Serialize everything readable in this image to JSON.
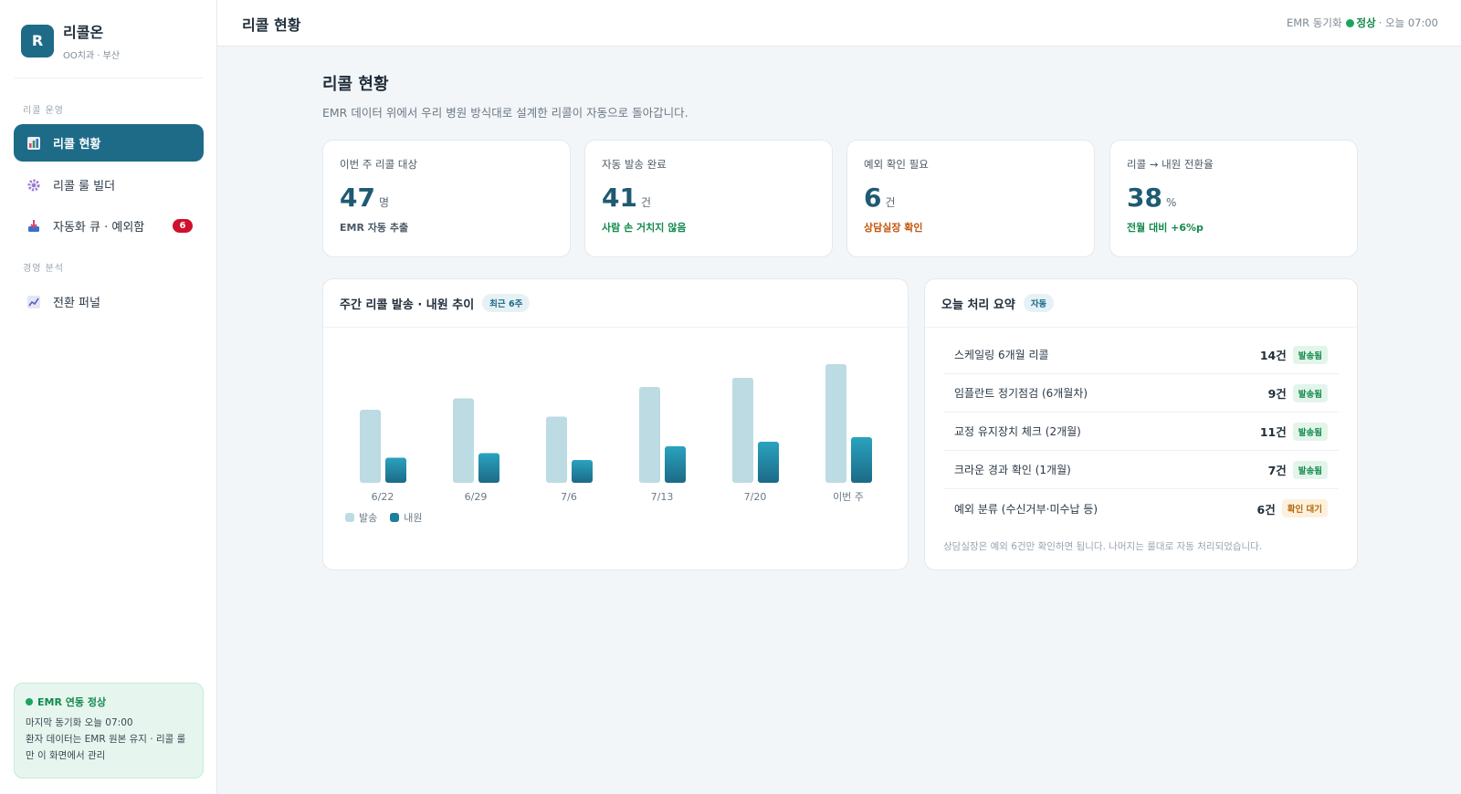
{
  "brand": {
    "initial": "R",
    "name": "리콜온",
    "sub": "OO치과 · 부산"
  },
  "sidebar": {
    "section_recall": "리콜 운영",
    "section_analysis": "경영 분석",
    "items": [
      {
        "label": "리콜 현황",
        "icon": "bar-chart-icon"
      },
      {
        "label": "리콜 룰 빌더",
        "icon": "gear-icon"
      },
      {
        "label": "자동화 큐 · 예외함",
        "icon": "inbox-icon",
        "badge": "6"
      },
      {
        "label": "전환 퍼널",
        "icon": "line-chart-icon"
      }
    ],
    "status": {
      "title": "EMR 연동 정상",
      "line1": "마지막 동기화 오늘 07:00",
      "line2": "환자 데이터는 EMR 원본 유지 · 리콜 룰만 이 화면에서 관리"
    }
  },
  "header": {
    "title": "리콜 현황",
    "sync_prefix": "EMR 동기화",
    "sync_status": "정상",
    "sync_time": "· 오늘 07:00"
  },
  "page": {
    "title": "리콜 현황",
    "subtitle": "EMR 데이터 위에서 우리 병원 방식대로 설계한 리콜이 자동으로 돌아갑니다."
  },
  "kpis": [
    {
      "label": "이번 주 리콜 대상",
      "value": "47",
      "unit": "명",
      "foot": "EMR 자동 추출",
      "foot_color": "#4b5966"
    },
    {
      "label": "자동 발송 완료",
      "value": "41",
      "unit": "건",
      "foot": "사람 손 거치지 않음",
      "foot_color": "#138a4d"
    },
    {
      "label": "예외 확인 필요",
      "value": "6",
      "unit": "건",
      "foot": "상담실장 확인",
      "foot_color": "#c2560c"
    },
    {
      "label": "리콜 → 내원 전환율",
      "value": "38",
      "unit": "%",
      "foot": "전월 대비 +6%p",
      "foot_color": "#138a4d"
    }
  ],
  "chart_panel": {
    "title": "주간 리콜 발송 · 내원 추이",
    "pill": "최근 6주"
  },
  "chart_data": {
    "type": "bar",
    "categories": [
      "6/22",
      "6/29",
      "7/6",
      "7/13",
      "7/20",
      "이번 주"
    ],
    "series": [
      {
        "name": "발송",
        "values": [
          32,
          37,
          29,
          42,
          46,
          52
        ],
        "color": "#bcdbe3"
      },
      {
        "name": "내원",
        "values": [
          11,
          13,
          10,
          16,
          18,
          20
        ],
        "color": "#1e7f9d"
      }
    ],
    "ylim": [
      0,
      60
    ],
    "legend": "bottom-left"
  },
  "summary": {
    "title": "오늘 처리 요약",
    "pill": "자동",
    "rows": [
      {
        "label": "스케일링 6개월 리콜",
        "count": "14건",
        "tag": "발송됨",
        "kind": "ok"
      },
      {
        "label": "임플란트 정기점검 (6개월차)",
        "count": "9건",
        "tag": "발송됨",
        "kind": "ok"
      },
      {
        "label": "교정 유지장치 체크 (2개월)",
        "count": "11건",
        "tag": "발송됨",
        "kind": "ok"
      },
      {
        "label": "크라운 경과 확인 (1개월)",
        "count": "7건",
        "tag": "발송됨",
        "kind": "ok"
      },
      {
        "label": "예외 분류 (수신거부·미수납 등)",
        "count": "6건",
        "tag": "확인 대기",
        "kind": "warn"
      }
    ],
    "note": "상담실장은 예외 6건만 확인하면 됩니다. 나머지는 룰대로 자동 처리되었습니다."
  }
}
